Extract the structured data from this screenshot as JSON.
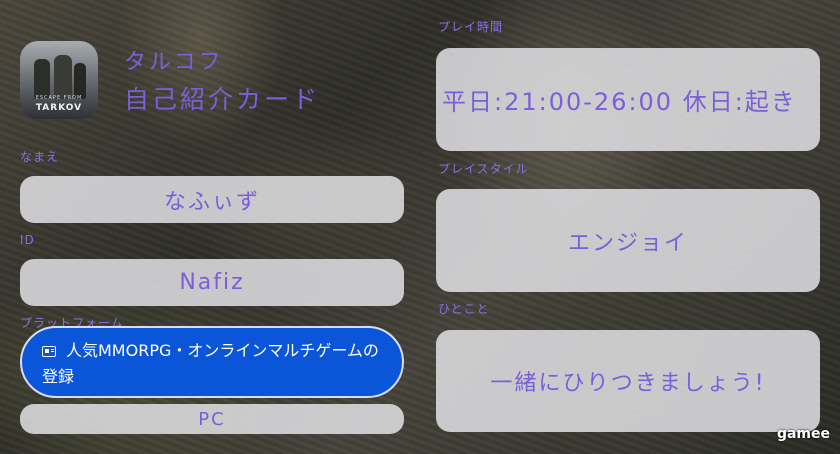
{
  "header": {
    "title_line1": "タルコフ",
    "title_line2": "自己紹介カード",
    "logo_text_top": "ESCAPE FROM",
    "logo_text": "TARKOV"
  },
  "fields": {
    "name": {
      "label": "なまえ",
      "value": "なふぃず"
    },
    "id": {
      "label": "ID",
      "value": "Nafiz"
    },
    "platform": {
      "label": "プラットフォーム",
      "value": "PC"
    },
    "playtime": {
      "label": "プレイ時間",
      "value": "平日:21:00-26:00 休日:起き"
    },
    "playstyle": {
      "label": "プレイスタイル",
      "value": "エンジョイ"
    },
    "comment": {
      "label": "ひとこと",
      "value": "一緒にひりつきましょう!"
    }
  },
  "ad": {
    "text": "人気MMORPG・オンラインマルチゲームの登録",
    "icon": "ad-card-icon"
  },
  "brand": "gamee",
  "colors": {
    "accent": "#7a5fd9",
    "card": "#e1e1e4",
    "ad_bg": "#0b55d9"
  }
}
